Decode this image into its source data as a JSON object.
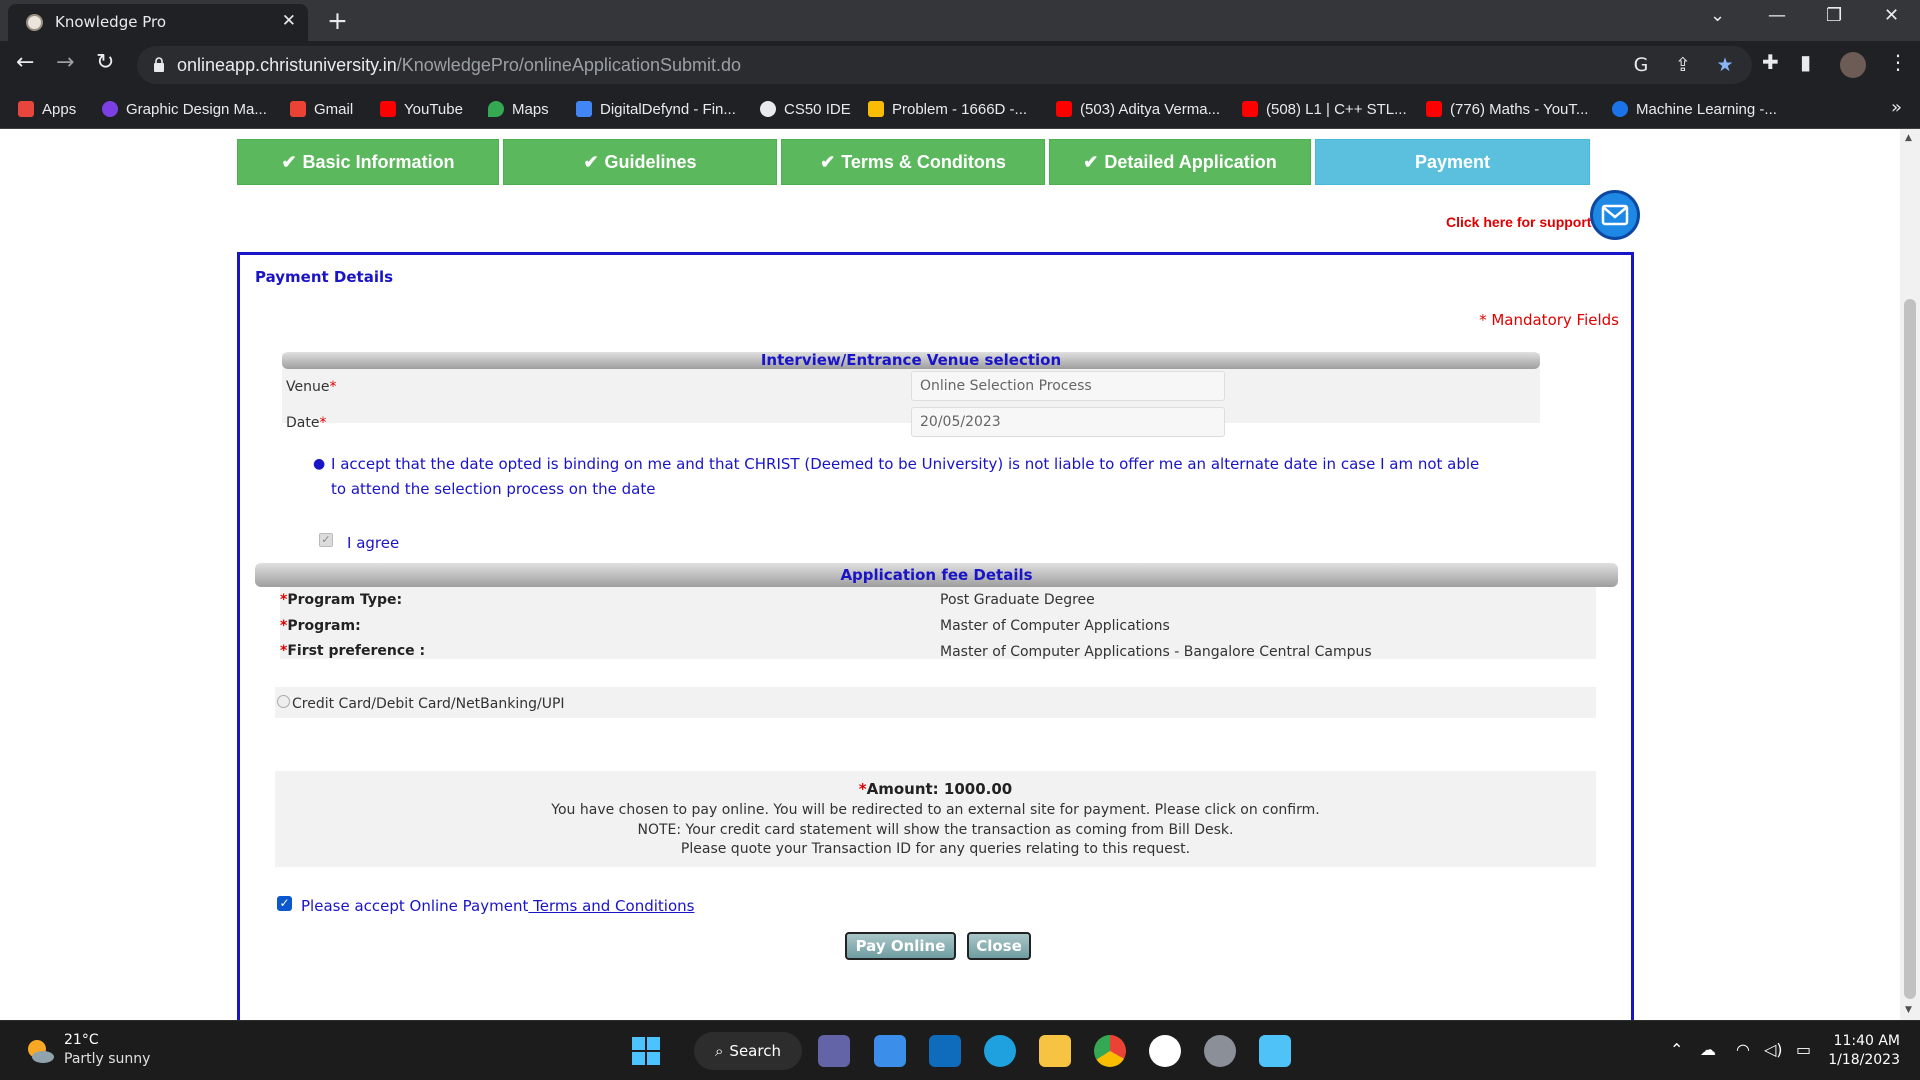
{
  "browser": {
    "tab_title": "Knowledge Pro",
    "url_host": "onlineapp.christuniversity.in",
    "url_path": "/KnowledgePro/onlineApplicationSubmit.do",
    "bookmarks": [
      {
        "label": "Apps",
        "icon": "apps-grid-icon",
        "color": "#e8453c"
      },
      {
        "label": "Graphic Design Ma...",
        "icon": "graphic-design-icon",
        "color": "#7b3fe4"
      },
      {
        "label": "Gmail",
        "icon": "gmail-icon",
        "color": "#ea4335"
      },
      {
        "label": "YouTube",
        "icon": "youtube-icon",
        "color": "#ff0000"
      },
      {
        "label": "Maps",
        "icon": "maps-icon",
        "color": "#34a853"
      },
      {
        "label": "DigitalDefynd - Fin...",
        "icon": "digitaldefynd-icon",
        "color": "#4285f4"
      },
      {
        "label": "CS50 IDE",
        "icon": "cs50-icon",
        "color": "#e8eaed"
      },
      {
        "label": "Problem - 1666D -...",
        "icon": "codeforces-icon",
        "color": "#fbbc04"
      },
      {
        "label": "(503) Aditya Verma...",
        "icon": "youtube-icon",
        "color": "#ff0000"
      },
      {
        "label": "(508) L1 | C++ STL...",
        "icon": "youtube-icon",
        "color": "#ff0000"
      },
      {
        "label": "(776) Maths - YouT...",
        "icon": "youtube-icon",
        "color": "#ff0000"
      },
      {
        "label": "Machine Learning -...",
        "icon": "coursera-icon",
        "color": "#1a73e8"
      }
    ]
  },
  "steps": [
    {
      "label": "Basic Information",
      "done": true
    },
    {
      "label": "Guidelines",
      "done": true
    },
    {
      "label": "Terms & Conditons",
      "done": true
    },
    {
      "label": "Detailed Application",
      "done": true
    },
    {
      "label": "Payment",
      "done": false
    }
  ],
  "support_label": "Click here for support",
  "panel": {
    "title": "Payment Details",
    "mandatory_note": "* Mandatory Fields",
    "venue_section": {
      "header": "Interview/Entrance Venue selection",
      "venue_label": "Venue",
      "venue_value": "Online Selection Process",
      "date_label": "Date",
      "date_value": "20/05/2023",
      "declaration": "I accept that the date opted is binding on me and that CHRIST (Deemed to be University) is not liable to offer me an alternate date in case I am not able to attend the selection process on the date",
      "agree_label": "I agree"
    },
    "fee_section": {
      "header": "Application fee Details",
      "program_type_label": "Program Type:",
      "program_type_value": "Post Graduate Degree",
      "program_label": "Program:",
      "program_value": "Master of Computer Applications",
      "preference_label": "First preference :",
      "preference_value": "Master of Computer Applications - Bangalore Central Campus"
    },
    "payment_method": "Credit Card/Debit Card/NetBanking/UPI",
    "amount_label": "Amount: 1000.00",
    "notes": [
      "You have chosen to pay online. You will be redirected to an external site for payment. Please click on confirm.",
      "NOTE: Your credit card statement will show the transaction as coming from Bill Desk.",
      "Please quote your Transaction ID for any queries relating to this request."
    ],
    "terms_prefix": "Please accept Online Payment",
    "terms_link": " Terms and Conditions",
    "pay_button": "Pay Online",
    "close_button": "Close"
  },
  "taskbar": {
    "temperature": "21°C",
    "weather": "Partly sunny",
    "search_label": "Search",
    "time": "11:40 AM",
    "date": "1/18/2023"
  }
}
